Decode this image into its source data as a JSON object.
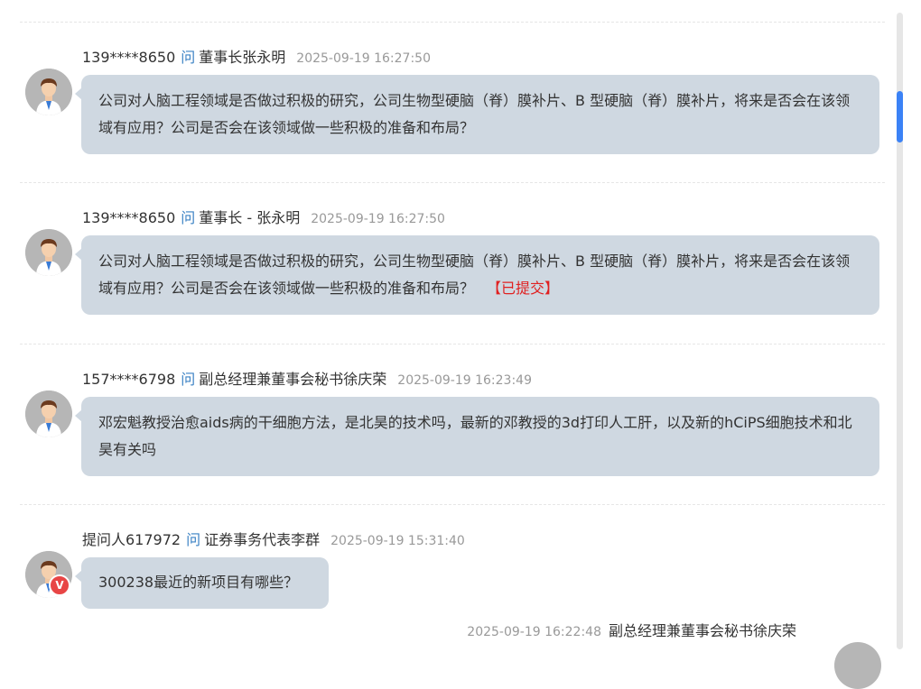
{
  "questions": [
    {
      "asker": "139****8650",
      "ask_word": "问",
      "target": "董事长张永明",
      "time": "2025-09-19 16:27:50",
      "content": "公司对人脑工程领域是否做过积极的研究，公司生物型硬脑（脊）膜补片、B 型硬脑（脊）膜补片，将来是否会在该领域有应用？公司是否会在该领域做一些积极的准备和布局？",
      "status": ""
    },
    {
      "asker": "139****8650",
      "ask_word": "问",
      "target": "董事长 - 张永明",
      "time": "2025-09-19 16:27:50",
      "content": "公司对人脑工程领域是否做过积极的研究，公司生物型硬脑（脊）膜补片、B 型硬脑（脊）膜补片，将来是否会在该领域有应用？公司是否会在该领域做一些积极的准备和布局？",
      "status": "【已提交】"
    },
    {
      "asker": "157****6798",
      "ask_word": "问",
      "target": "副总经理兼董事会秘书徐庆荣",
      "time": "2025-09-19 16:23:49",
      "content": "邓宏魁教授治愈aids病的干细胞方法，是北昊的技术吗，最新的邓教授的3d打印人工肝，以及新的hCiPS细胞技术和北昊有关吗",
      "status": ""
    },
    {
      "asker": "提问人617972",
      "ask_word": "问",
      "target": "证券事务代表李群",
      "time": "2025-09-19 15:31:40",
      "content": "300238最近的新项目有哪些？",
      "status": "",
      "badge": "V"
    }
  ],
  "reply": {
    "time": "2025-09-19 16:22:48",
    "name": "副总经理兼董事会秘书徐庆荣"
  },
  "colors": {
    "bubble": "#cfd8e1",
    "ask_word": "#3b82c4",
    "status": "#e02020",
    "scroll_thumb": "#3b82f6"
  }
}
